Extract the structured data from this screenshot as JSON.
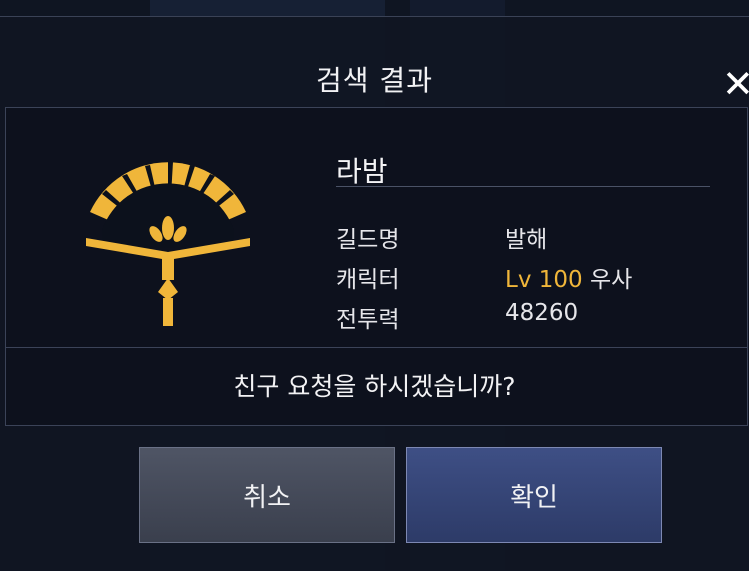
{
  "dialog": {
    "title": "검색 결과",
    "close_icon": "close-icon",
    "profile": {
      "icon": "fan-emblem-icon",
      "name": "라밤",
      "rows": [
        {
          "label": "길드명",
          "value": "발해"
        },
        {
          "label": "캐릭터",
          "level": "Lv 100",
          "value": "우사"
        },
        {
          "label": "전투력",
          "value": "48260"
        }
      ]
    },
    "question": "친구 요청을 하시겠습니까?",
    "buttons": {
      "cancel": "취소",
      "confirm": "확인"
    }
  },
  "colors": {
    "accent_gold": "#f0b63a",
    "confirm_button": "#3e4f85",
    "cancel_button": "#4f5565"
  }
}
